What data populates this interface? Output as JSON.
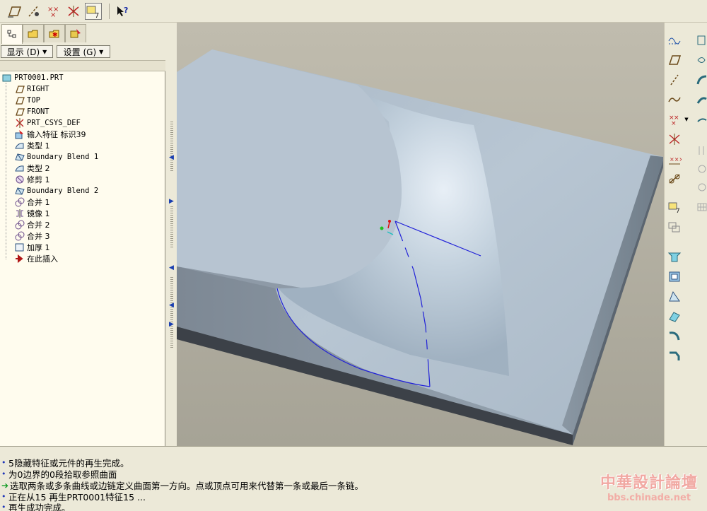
{
  "panel": {
    "show_menu_label": "显示 (D)",
    "settings_menu_label": "设置 (G)"
  },
  "model_tree": {
    "items": [
      {
        "label": "PRT0001.PRT",
        "icon": "part-icon"
      },
      {
        "label": "RIGHT",
        "icon": "datum-plane-icon"
      },
      {
        "label": "TOP",
        "icon": "datum-plane-icon"
      },
      {
        "label": "FRONT",
        "icon": "datum-plane-icon"
      },
      {
        "label": "PRT_CSYS_DEF",
        "icon": "coordinate-system-icon"
      },
      {
        "label": "输入特征 标识39",
        "icon": "import-feature-icon"
      },
      {
        "label": "类型 1",
        "icon": "surface-icon"
      },
      {
        "label": "Boundary Blend 1",
        "icon": "boundary-blend-icon"
      },
      {
        "label": "类型 2",
        "icon": "surface-icon"
      },
      {
        "label": "修剪 1",
        "icon": "trim-icon"
      },
      {
        "label": "Boundary Blend 2",
        "icon": "boundary-blend-icon"
      },
      {
        "label": "合并 1",
        "icon": "merge-icon"
      },
      {
        "label": "镜像 1",
        "icon": "mirror-icon"
      },
      {
        "label": "合并 2",
        "icon": "merge-icon"
      },
      {
        "label": "合并 3",
        "icon": "merge-icon"
      },
      {
        "label": "加厚 1",
        "icon": "thicken-icon"
      },
      {
        "label": "在此插入",
        "icon": "insert-here-arrow-icon"
      }
    ]
  },
  "messages": [
    {
      "text": "5隐藏特征或元件的再生完成。",
      "marker": "bullet"
    },
    {
      "text": "为0边界的0段拾取参照曲面",
      "marker": "bullet"
    },
    {
      "text": "选取两条或多条曲线或边链定义曲面第一方向。点或顶点可用来代替第一条或最后一条链。",
      "marker": "arrow"
    },
    {
      "text": "正在从15 再生PRT0001特征15 ...",
      "marker": "bullet"
    },
    {
      "text": "再生成功完成。",
      "marker": "bullet"
    }
  ],
  "watermark": {
    "title": "中華設計論壇",
    "url": "bbs.chinade.net"
  },
  "colors": {
    "viewport_bg": "#b4b0a2",
    "model_top": "#b6c5d4",
    "model_side": "#3c4148",
    "curve_blue": "#2020d8",
    "tree_bg": "#fffcee",
    "watermark": "#f1a8a2"
  }
}
